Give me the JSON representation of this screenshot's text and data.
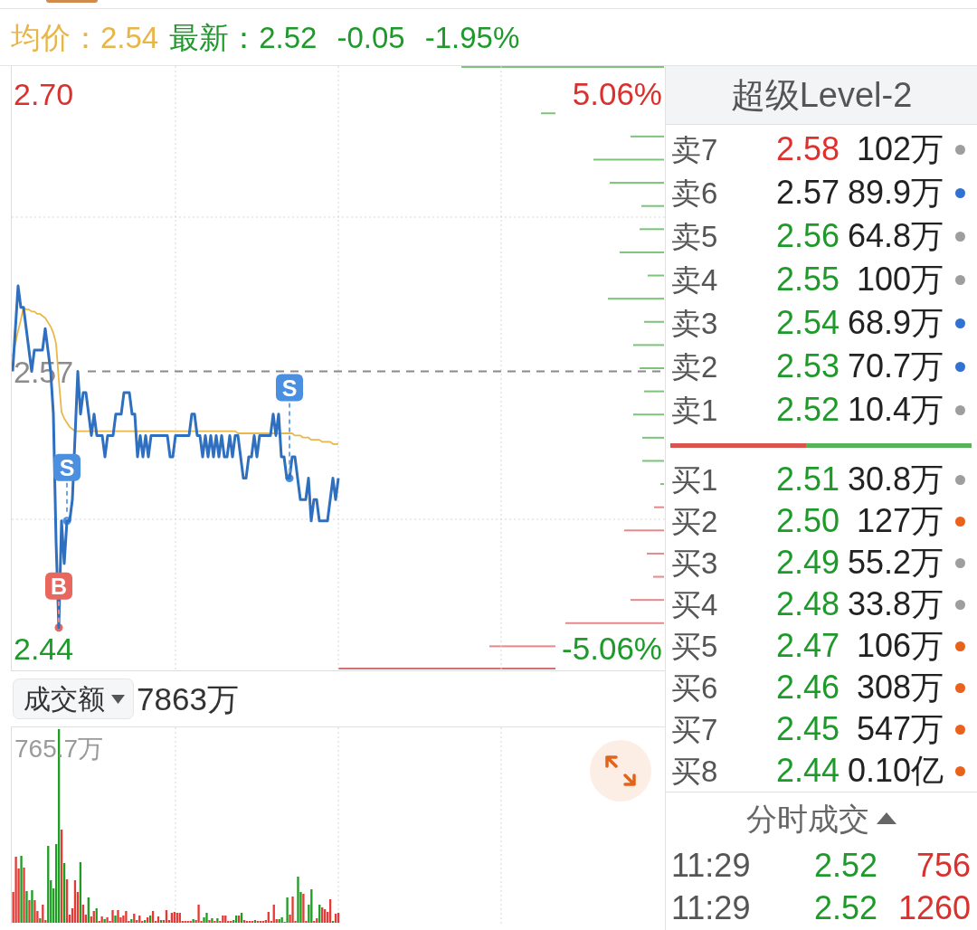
{
  "quote_bar": {
    "average": {
      "text": "均价：2.54",
      "color": "#e8b548"
    },
    "latest": {
      "text": "最新：2.52",
      "color": "#1e9a2b"
    },
    "change": {
      "text": "-0.05",
      "color": "#1e9a2b"
    },
    "change_percent": {
      "text": "-1.95%",
      "color": "#1e9a2b"
    }
  },
  "price_chart": {
    "chart_data": {
      "type": "line",
      "ylim": [
        2.43,
        2.713
      ],
      "yticks": [
        {
          "value": 2.7,
          "label": "2.70"
        },
        {
          "value": 2.57,
          "label": "2.57"
        },
        {
          "value": 2.44,
          "label": "2.44"
        }
      ],
      "ref_lines": [
        {
          "axis": "y",
          "value": 2.57
        }
      ],
      "categories": [
        null,
        null,
        null,
        null,
        null,
        null,
        null,
        null,
        null,
        null,
        null,
        null,
        null,
        null,
        null,
        null,
        null,
        null,
        null,
        null,
        null,
        null,
        null,
        null,
        null,
        null,
        null,
        null,
        null,
        null,
        null,
        null,
        null,
        null,
        null,
        null,
        null,
        null,
        null,
        null,
        null,
        null,
        null,
        null,
        null,
        null,
        null,
        null,
        null,
        null,
        null,
        null,
        null,
        null,
        null,
        null,
        null,
        null,
        null,
        null,
        null,
        null,
        null,
        null,
        null,
        null,
        null,
        null,
        null,
        null,
        null,
        null,
        null,
        null,
        null,
        null,
        null,
        null,
        null,
        null,
        null,
        null,
        null,
        null,
        null,
        null,
        null,
        null,
        null,
        null,
        null,
        null,
        null,
        null,
        null,
        null,
        null,
        null,
        null,
        null,
        null,
        null,
        null,
        null,
        null,
        null,
        null,
        null,
        null,
        null,
        null,
        null,
        null,
        null,
        null,
        null,
        null,
        null,
        null,
        null,
        null,
        null,
        null,
        null,
        null,
        null,
        null,
        null,
        null,
        null,
        null,
        null,
        null,
        null,
        null,
        null,
        null,
        null,
        null,
        null,
        null,
        null,
        null,
        null,
        null,
        null,
        null,
        null,
        null,
        null,
        null,
        null,
        null,
        null,
        null,
        null,
        null,
        null,
        null,
        null,
        null,
        null,
        null,
        null,
        null,
        null,
        null,
        null,
        null,
        null,
        null,
        null,
        null,
        null,
        null,
        null,
        null,
        null,
        null,
        null,
        null,
        null,
        null,
        null,
        null,
        null,
        null,
        null,
        null,
        null,
        null,
        null,
        null,
        null,
        null,
        null,
        null,
        null,
        null,
        null,
        null,
        null,
        null,
        null,
        null,
        null,
        null,
        null,
        null,
        null,
        null,
        null,
        null,
        null,
        null,
        null,
        null,
        null,
        null,
        null,
        null,
        null,
        null,
        null,
        null,
        null,
        null,
        null,
        null,
        null,
        null,
        null,
        null,
        null,
        null,
        null,
        null,
        null,
        null,
        null,
        null
      ],
      "series": [
        {
          "color": "#2f6fbf",
          "values": [
            2.57,
            2.59,
            2.61,
            2.6,
            2.6,
            2.59,
            2.58,
            2.57,
            2.58,
            2.58,
            2.58,
            2.58,
            2.59,
            2.58,
            2.57,
            2.55,
            2.49,
            2.45,
            2.5,
            2.48,
            2.5,
            2.5,
            2.51,
            2.54,
            2.57,
            2.55,
            2.56,
            2.56,
            2.55,
            2.54,
            2.55,
            2.54,
            2.54,
            2.54,
            2.53,
            2.54,
            2.54,
            2.54,
            2.55,
            2.55,
            2.55,
            2.56,
            2.56,
            2.56,
            2.55,
            2.55,
            2.53,
            2.54,
            2.53,
            2.54,
            2.53,
            2.54,
            2.54,
            2.54,
            2.54,
            2.54,
            2.54,
            2.54,
            2.53,
            2.53,
            2.54,
            2.54,
            2.54,
            2.54,
            2.54,
            2.54,
            2.55,
            2.55,
            2.54,
            2.54,
            2.53,
            2.54,
            2.53,
            2.54,
            2.53,
            2.54,
            2.53,
            2.54,
            2.53,
            2.53,
            2.54,
            2.53,
            2.54,
            2.54,
            2.53,
            2.52,
            2.52,
            2.53,
            2.53,
            2.54,
            2.53,
            2.54,
            2.54,
            2.54,
            2.54,
            2.54,
            2.55,
            2.54,
            2.55,
            2.53,
            2.53,
            2.52,
            2.52,
            2.53,
            2.53,
            2.52,
            2.51,
            2.51,
            2.51,
            2.52,
            2.5,
            2.51,
            2.51,
            2.5,
            2.5,
            2.5,
            2.5,
            2.51,
            2.52,
            2.51,
            2.52,
            null,
            null,
            null,
            null,
            null,
            null,
            null,
            null,
            null,
            null,
            null,
            null,
            null,
            null,
            null,
            null,
            null,
            null,
            null,
            null,
            null,
            null,
            null,
            null,
            null,
            null,
            null,
            null,
            null,
            null,
            null,
            null,
            null,
            null,
            null,
            null,
            null,
            null,
            null,
            null,
            null,
            null,
            null,
            null,
            null,
            null,
            null,
            null,
            null,
            null,
            null,
            null,
            null,
            null,
            null,
            null,
            null,
            null,
            null,
            null,
            null,
            null,
            null,
            null,
            null,
            null,
            null,
            null,
            null,
            null,
            null,
            null,
            null,
            null,
            null,
            null,
            null,
            null,
            null,
            null,
            null,
            null,
            null,
            null,
            null,
            null,
            null,
            null,
            null,
            null,
            null,
            null,
            null,
            null,
            null,
            null,
            null,
            null,
            null,
            null,
            null,
            null,
            null,
            null,
            null,
            null,
            null,
            null,
            null,
            null,
            null,
            null,
            null,
            null,
            null,
            null,
            null,
            null,
            null,
            null
          ]
        },
        {
          "color": "#e8b84a",
          "values": [
            2.577,
            2.583,
            2.589,
            2.594,
            2.6,
            2.599,
            2.599,
            2.598,
            2.598,
            2.597,
            2.597,
            2.596,
            2.595,
            2.593,
            2.591,
            2.588,
            2.583,
            2.566,
            2.551,
            2.548,
            2.546,
            2.544,
            2.543,
            2.542,
            2.542,
            2.542,
            2.542,
            2.542,
            2.542,
            2.542,
            2.542,
            2.542,
            2.542,
            2.542,
            2.542,
            2.542,
            2.542,
            2.542,
            2.542,
            2.542,
            2.542,
            2.542,
            2.542,
            2.542,
            2.542,
            2.542,
            2.542,
            2.542,
            2.542,
            2.542,
            2.542,
            2.542,
            2.542,
            2.542,
            2.542,
            2.542,
            2.542,
            2.542,
            2.542,
            2.542,
            2.542,
            2.542,
            2.542,
            2.542,
            2.542,
            2.542,
            2.542,
            2.542,
            2.542,
            2.542,
            2.542,
            2.542,
            2.542,
            2.542,
            2.542,
            2.542,
            2.542,
            2.542,
            2.542,
            2.542,
            2.542,
            2.542,
            2.542,
            2.541,
            2.541,
            2.541,
            2.541,
            2.541,
            2.541,
            2.541,
            2.541,
            2.541,
            2.541,
            2.541,
            2.541,
            2.541,
            2.541,
            2.541,
            2.541,
            2.541,
            2.541,
            2.541,
            2.541,
            2.541,
            2.54,
            2.54,
            2.54,
            2.539,
            2.539,
            2.539,
            2.538,
            2.538,
            2.538,
            2.538,
            2.537,
            2.537,
            2.537,
            2.537,
            2.536,
            2.536,
            2.536,
            null,
            null,
            null,
            null,
            null,
            null,
            null,
            null,
            null,
            null,
            null,
            null,
            null,
            null,
            null,
            null,
            null,
            null,
            null,
            null,
            null,
            null,
            null,
            null,
            null,
            null,
            null,
            null,
            null,
            null,
            null,
            null,
            null,
            null,
            null,
            null,
            null,
            null,
            null,
            null,
            null,
            null,
            null,
            null,
            null,
            null,
            null,
            null,
            null,
            null,
            null,
            null,
            null,
            null,
            null,
            null,
            null,
            null,
            null,
            null,
            null,
            null,
            null,
            null,
            null,
            null,
            null,
            null,
            null,
            null,
            null,
            null,
            null,
            null,
            null,
            null,
            null,
            null,
            null,
            null,
            null,
            null,
            null,
            null,
            null,
            null,
            null,
            null,
            null,
            null,
            null,
            null,
            null,
            null,
            null,
            null,
            null,
            null,
            null,
            null,
            null,
            null,
            null,
            null,
            null,
            null,
            null,
            null,
            null,
            null,
            null,
            null,
            null,
            null,
            null,
            null,
            null,
            null,
            null,
            null
          ]
        }
      ]
    },
    "trade_signals": [
      {
        "kind": "sell",
        "label": "S"
      },
      {
        "kind": "buy",
        "label": "B"
      },
      {
        "kind": "sell",
        "label": "S"
      }
    ],
    "change_labels": [
      {
        "text": "5.06%",
        "color": "#d8322f"
      },
      {
        "text": "-5.06%",
        "color": "#1e9a2b"
      }
    ]
  },
  "turnover": {
    "dropdown": {
      "label": "成交额"
    },
    "value": "7863万"
  },
  "turnover_chart": {
    "max_label": "765.7万"
  },
  "order_book": {
    "title": "超级Level-2",
    "asks": [
      {
        "label": "卖7",
        "price": {
          "text": "2.58",
          "color": "#e0302d"
        },
        "volume": "102万",
        "color": "#9e9e9e"
      },
      {
        "label": "卖6",
        "price": {
          "text": "2.57",
          "color": "#222222"
        },
        "volume": "89.9万",
        "color": "#2f72d2"
      },
      {
        "label": "卖5",
        "price": {
          "text": "2.56",
          "color": "#1e9a2b"
        },
        "volume": "64.8万",
        "color": "#9e9e9e"
      },
      {
        "label": "卖4",
        "price": {
          "text": "2.55",
          "color": "#1e9a2b"
        },
        "volume": "100万",
        "color": "#9e9e9e"
      },
      {
        "label": "卖3",
        "price": {
          "text": "2.54",
          "color": "#1e9a2b"
        },
        "volume": "68.9万",
        "color": "#2f72d2"
      },
      {
        "label": "卖2",
        "price": {
          "text": "2.53",
          "color": "#1e9a2b"
        },
        "volume": "70.7万",
        "color": "#2f72d2"
      },
      {
        "label": "卖1",
        "price": {
          "text": "2.52",
          "color": "#1e9a2b"
        },
        "volume": "10.4万",
        "color": "#9e9e9e"
      }
    ],
    "ratio_bar": {
      "level": 0.45
    },
    "bids": [
      {
        "label": "买1",
        "price": {
          "text": "2.51",
          "color": "#1e9a2b"
        },
        "volume": "30.8万",
        "color": "#9e9e9e"
      },
      {
        "label": "买2",
        "price": {
          "text": "2.50",
          "color": "#1e9a2b"
        },
        "volume": "127万",
        "color": "#e8621c"
      },
      {
        "label": "买3",
        "price": {
          "text": "2.49",
          "color": "#1e9a2b"
        },
        "volume": "55.2万",
        "color": "#9e9e9e"
      },
      {
        "label": "买4",
        "price": {
          "text": "2.48",
          "color": "#1e9a2b"
        },
        "volume": "33.8万",
        "color": "#9e9e9e"
      },
      {
        "label": "买5",
        "price": {
          "text": "2.47",
          "color": "#1e9a2b"
        },
        "volume": "106万",
        "color": "#e8621c"
      },
      {
        "label": "买6",
        "price": {
          "text": "2.46",
          "color": "#1e9a2b"
        },
        "volume": "308万",
        "color": "#e8621c"
      },
      {
        "label": "买7",
        "price": {
          "text": "2.45",
          "color": "#1e9a2b"
        },
        "volume": "547万",
        "color": "#e8621c"
      },
      {
        "label": "买8",
        "price": {
          "text": "2.44",
          "color": "#1e9a2b"
        },
        "volume": "0.10亿",
        "color": "#e8621c"
      }
    ]
  },
  "trades": {
    "title": "分时成交",
    "rows": [
      {
        "time": "11:29",
        "price": {
          "text": "2.52",
          "color": "#1e9a2b"
        },
        "volume": {
          "text": "756",
          "color": "#d8322f"
        }
      },
      {
        "time": "11:29",
        "price": {
          "text": "2.52",
          "color": "#1e9a2b"
        },
        "volume": {
          "text": "1260",
          "color": "#d8322f"
        }
      }
    ]
  }
}
